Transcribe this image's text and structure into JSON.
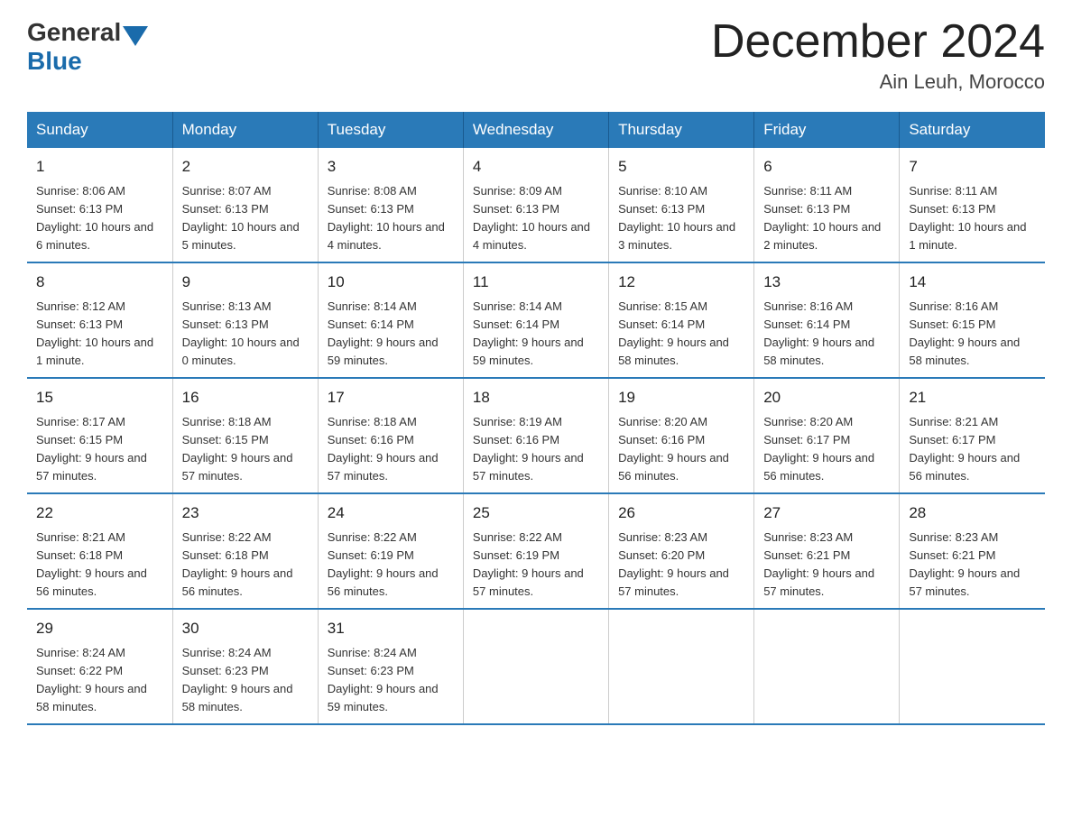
{
  "header": {
    "logo_general": "General",
    "logo_blue": "Blue",
    "month_title": "December 2024",
    "location": "Ain Leuh, Morocco"
  },
  "weekdays": [
    "Sunday",
    "Monday",
    "Tuesday",
    "Wednesday",
    "Thursday",
    "Friday",
    "Saturday"
  ],
  "weeks": [
    [
      {
        "day": "1",
        "sunrise": "8:06 AM",
        "sunset": "6:13 PM",
        "daylight": "10 hours and 6 minutes."
      },
      {
        "day": "2",
        "sunrise": "8:07 AM",
        "sunset": "6:13 PM",
        "daylight": "10 hours and 5 minutes."
      },
      {
        "day": "3",
        "sunrise": "8:08 AM",
        "sunset": "6:13 PM",
        "daylight": "10 hours and 4 minutes."
      },
      {
        "day": "4",
        "sunrise": "8:09 AM",
        "sunset": "6:13 PM",
        "daylight": "10 hours and 4 minutes."
      },
      {
        "day": "5",
        "sunrise": "8:10 AM",
        "sunset": "6:13 PM",
        "daylight": "10 hours and 3 minutes."
      },
      {
        "day": "6",
        "sunrise": "8:11 AM",
        "sunset": "6:13 PM",
        "daylight": "10 hours and 2 minutes."
      },
      {
        "day": "7",
        "sunrise": "8:11 AM",
        "sunset": "6:13 PM",
        "daylight": "10 hours and 1 minute."
      }
    ],
    [
      {
        "day": "8",
        "sunrise": "8:12 AM",
        "sunset": "6:13 PM",
        "daylight": "10 hours and 1 minute."
      },
      {
        "day": "9",
        "sunrise": "8:13 AM",
        "sunset": "6:13 PM",
        "daylight": "10 hours and 0 minutes."
      },
      {
        "day": "10",
        "sunrise": "8:14 AM",
        "sunset": "6:14 PM",
        "daylight": "9 hours and 59 minutes."
      },
      {
        "day": "11",
        "sunrise": "8:14 AM",
        "sunset": "6:14 PM",
        "daylight": "9 hours and 59 minutes."
      },
      {
        "day": "12",
        "sunrise": "8:15 AM",
        "sunset": "6:14 PM",
        "daylight": "9 hours and 58 minutes."
      },
      {
        "day": "13",
        "sunrise": "8:16 AM",
        "sunset": "6:14 PM",
        "daylight": "9 hours and 58 minutes."
      },
      {
        "day": "14",
        "sunrise": "8:16 AM",
        "sunset": "6:15 PM",
        "daylight": "9 hours and 58 minutes."
      }
    ],
    [
      {
        "day": "15",
        "sunrise": "8:17 AM",
        "sunset": "6:15 PM",
        "daylight": "9 hours and 57 minutes."
      },
      {
        "day": "16",
        "sunrise": "8:18 AM",
        "sunset": "6:15 PM",
        "daylight": "9 hours and 57 minutes."
      },
      {
        "day": "17",
        "sunrise": "8:18 AM",
        "sunset": "6:16 PM",
        "daylight": "9 hours and 57 minutes."
      },
      {
        "day": "18",
        "sunrise": "8:19 AM",
        "sunset": "6:16 PM",
        "daylight": "9 hours and 57 minutes."
      },
      {
        "day": "19",
        "sunrise": "8:20 AM",
        "sunset": "6:16 PM",
        "daylight": "9 hours and 56 minutes."
      },
      {
        "day": "20",
        "sunrise": "8:20 AM",
        "sunset": "6:17 PM",
        "daylight": "9 hours and 56 minutes."
      },
      {
        "day": "21",
        "sunrise": "8:21 AM",
        "sunset": "6:17 PM",
        "daylight": "9 hours and 56 minutes."
      }
    ],
    [
      {
        "day": "22",
        "sunrise": "8:21 AM",
        "sunset": "6:18 PM",
        "daylight": "9 hours and 56 minutes."
      },
      {
        "day": "23",
        "sunrise": "8:22 AM",
        "sunset": "6:18 PM",
        "daylight": "9 hours and 56 minutes."
      },
      {
        "day": "24",
        "sunrise": "8:22 AM",
        "sunset": "6:19 PM",
        "daylight": "9 hours and 56 minutes."
      },
      {
        "day": "25",
        "sunrise": "8:22 AM",
        "sunset": "6:19 PM",
        "daylight": "9 hours and 57 minutes."
      },
      {
        "day": "26",
        "sunrise": "8:23 AM",
        "sunset": "6:20 PM",
        "daylight": "9 hours and 57 minutes."
      },
      {
        "day": "27",
        "sunrise": "8:23 AM",
        "sunset": "6:21 PM",
        "daylight": "9 hours and 57 minutes."
      },
      {
        "day": "28",
        "sunrise": "8:23 AM",
        "sunset": "6:21 PM",
        "daylight": "9 hours and 57 minutes."
      }
    ],
    [
      {
        "day": "29",
        "sunrise": "8:24 AM",
        "sunset": "6:22 PM",
        "daylight": "9 hours and 58 minutes."
      },
      {
        "day": "30",
        "sunrise": "8:24 AM",
        "sunset": "6:23 PM",
        "daylight": "9 hours and 58 minutes."
      },
      {
        "day": "31",
        "sunrise": "8:24 AM",
        "sunset": "6:23 PM",
        "daylight": "9 hours and 59 minutes."
      },
      {
        "day": "",
        "sunrise": "",
        "sunset": "",
        "daylight": ""
      },
      {
        "day": "",
        "sunrise": "",
        "sunset": "",
        "daylight": ""
      },
      {
        "day": "",
        "sunrise": "",
        "sunset": "",
        "daylight": ""
      },
      {
        "day": "",
        "sunrise": "",
        "sunset": "",
        "daylight": ""
      }
    ]
  ],
  "labels": {
    "sunrise": "Sunrise:",
    "sunset": "Sunset:",
    "daylight": "Daylight:"
  }
}
